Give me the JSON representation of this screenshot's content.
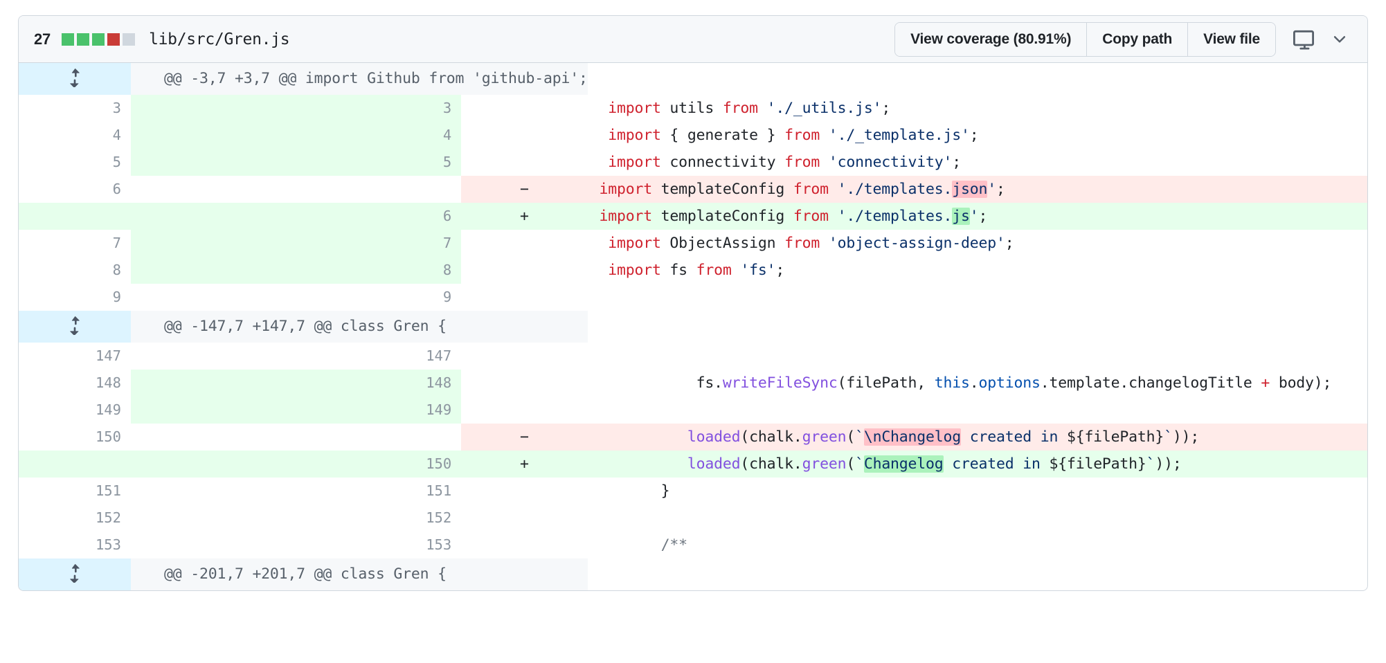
{
  "header": {
    "change_count": "27",
    "stat_blocks": [
      "#4ac26b",
      "#4ac26b",
      "#4ac26b",
      "#c93c37",
      "#d0d7de"
    ],
    "file_path": "lib/src/Gren.js",
    "buttons": [
      {
        "label": "View coverage (80.91%)",
        "name": "view-coverage-button"
      },
      {
        "label": "Copy path",
        "name": "copy-path-button"
      },
      {
        "label": "View file",
        "name": "view-file-button"
      }
    ],
    "icons": {
      "display": "display-icon",
      "chevron": "chevron-down-icon"
    }
  },
  "colors": {
    "accent_blue": "#0969da",
    "addition_bg": "#e6ffec",
    "deletion_bg": "#ffebe9",
    "hunk_bg": "#f6f8fa",
    "expand_bg": "#ddf4ff",
    "word_del_bg": "#ffc0c7",
    "word_add_bg": "#abf2bc",
    "border": "#d0d7de"
  },
  "hunks": [
    {
      "header": "@@ -3,7 +3,7 @@ import Github from 'github-api';",
      "rows": [
        {
          "type": "ctx",
          "old": "3",
          "new": "3",
          "marker": "",
          "gutter_green": true,
          "tokens": [
            {
              "t": "  ",
              "c": "pl"
            },
            {
              "t": "import",
              "c": "k"
            },
            {
              "t": " utils ",
              "c": "pl"
            },
            {
              "t": "from",
              "c": "k"
            },
            {
              "t": " ",
              "c": "pl"
            },
            {
              "t": "'./_utils.js'",
              "c": "s"
            },
            {
              "t": ";",
              "c": "pl"
            }
          ]
        },
        {
          "type": "ctx",
          "old": "4",
          "new": "4",
          "marker": "",
          "gutter_green": true,
          "tokens": [
            {
              "t": "  ",
              "c": "pl"
            },
            {
              "t": "import",
              "c": "k"
            },
            {
              "t": " { generate } ",
              "c": "pl"
            },
            {
              "t": "from",
              "c": "k"
            },
            {
              "t": " ",
              "c": "pl"
            },
            {
              "t": "'./_template.js'",
              "c": "s"
            },
            {
              "t": ";",
              "c": "pl"
            }
          ]
        },
        {
          "type": "ctx",
          "old": "5",
          "new": "5",
          "marker": "",
          "gutter_green": true,
          "tokens": [
            {
              "t": "  ",
              "c": "pl"
            },
            {
              "t": "import",
              "c": "k"
            },
            {
              "t": " connectivity ",
              "c": "pl"
            },
            {
              "t": "from",
              "c": "k"
            },
            {
              "t": " ",
              "c": "pl"
            },
            {
              "t": "'connectivity'",
              "c": "s"
            },
            {
              "t": ";",
              "c": "pl"
            }
          ]
        },
        {
          "type": "del",
          "old": "6",
          "new": "",
          "marker": "−",
          "gutter_green": false,
          "tokens": [
            {
              "t": " ",
              "c": "pl"
            },
            {
              "t": "import",
              "c": "k"
            },
            {
              "t": " templateConfig ",
              "c": "pl"
            },
            {
              "t": "from",
              "c": "k"
            },
            {
              "t": " ",
              "c": "pl"
            },
            {
              "t": "'./templates.",
              "c": "s"
            },
            {
              "t": "json",
              "c": "s",
              "hl": "del"
            },
            {
              "t": "'",
              "c": "s"
            },
            {
              "t": ";",
              "c": "pl"
            }
          ]
        },
        {
          "type": "add",
          "old": "",
          "new": "6",
          "marker": "+",
          "gutter_green": true,
          "tokens": [
            {
              "t": " ",
              "c": "pl"
            },
            {
              "t": "import",
              "c": "k"
            },
            {
              "t": " templateConfig ",
              "c": "pl"
            },
            {
              "t": "from",
              "c": "k"
            },
            {
              "t": " ",
              "c": "pl"
            },
            {
              "t": "'./templates.",
              "c": "s"
            },
            {
              "t": "js",
              "c": "s",
              "hl": "add"
            },
            {
              "t": "'",
              "c": "s"
            },
            {
              "t": ";",
              "c": "pl"
            }
          ]
        },
        {
          "type": "ctx",
          "old": "7",
          "new": "7",
          "marker": "",
          "gutter_green": true,
          "tokens": [
            {
              "t": "  ",
              "c": "pl"
            },
            {
              "t": "import",
              "c": "k"
            },
            {
              "t": " ObjectAssign ",
              "c": "pl"
            },
            {
              "t": "from",
              "c": "k"
            },
            {
              "t": " ",
              "c": "pl"
            },
            {
              "t": "'object-assign-deep'",
              "c": "s"
            },
            {
              "t": ";",
              "c": "pl"
            }
          ]
        },
        {
          "type": "ctx",
          "old": "8",
          "new": "8",
          "marker": "",
          "gutter_green": true,
          "tokens": [
            {
              "t": "  ",
              "c": "pl"
            },
            {
              "t": "import",
              "c": "k"
            },
            {
              "t": " fs ",
              "c": "pl"
            },
            {
              "t": "from",
              "c": "k"
            },
            {
              "t": " ",
              "c": "pl"
            },
            {
              "t": "'fs'",
              "c": "s"
            },
            {
              "t": ";",
              "c": "pl"
            }
          ]
        },
        {
          "type": "ctx",
          "old": "9",
          "new": "9",
          "marker": "",
          "gutter_green": false,
          "tokens": []
        }
      ]
    },
    {
      "header": "@@ -147,7 +147,7 @@ class Gren {",
      "rows": [
        {
          "type": "ctx",
          "old": "147",
          "new": "147",
          "marker": "",
          "gutter_green": false,
          "tokens": []
        },
        {
          "type": "ctx",
          "old": "148",
          "new": "148",
          "marker": "",
          "gutter_green": true,
          "tokens": [
            {
              "t": "            fs.",
              "c": "pl"
            },
            {
              "t": "writeFileSync",
              "c": "f"
            },
            {
              "t": "(filePath, ",
              "c": "pl"
            },
            {
              "t": "this",
              "c": "e"
            },
            {
              "t": ".",
              "c": "pl"
            },
            {
              "t": "options",
              "c": "e"
            },
            {
              "t": ".template.changelogTitle ",
              "c": "pl"
            },
            {
              "t": "+",
              "c": "k"
            },
            {
              "t": " body);",
              "c": "pl"
            }
          ]
        },
        {
          "type": "ctx",
          "old": "149",
          "new": "149",
          "marker": "",
          "gutter_green": true,
          "tokens": []
        },
        {
          "type": "del",
          "old": "150",
          "new": "",
          "marker": "−",
          "gutter_green": false,
          "tokens": [
            {
              "t": "           ",
              "c": "pl"
            },
            {
              "t": "loaded",
              "c": "f"
            },
            {
              "t": "(chalk.",
              "c": "pl"
            },
            {
              "t": "green",
              "c": "f"
            },
            {
              "t": "(",
              "c": "pl"
            },
            {
              "t": "`",
              "c": "s"
            },
            {
              "t": "\\nChangelog",
              "c": "s",
              "hl": "del"
            },
            {
              "t": " created in ",
              "c": "s"
            },
            {
              "t": "${filePath}",
              "c": "pl"
            },
            {
              "t": "`",
              "c": "s"
            },
            {
              "t": "));",
              "c": "pl"
            }
          ]
        },
        {
          "type": "add",
          "old": "",
          "new": "150",
          "marker": "+",
          "gutter_green": true,
          "tokens": [
            {
              "t": "           ",
              "c": "pl"
            },
            {
              "t": "loaded",
              "c": "f"
            },
            {
              "t": "(chalk.",
              "c": "pl"
            },
            {
              "t": "green",
              "c": "f"
            },
            {
              "t": "(",
              "c": "pl"
            },
            {
              "t": "`",
              "c": "s"
            },
            {
              "t": "Changelog",
              "c": "s",
              "hl": "add"
            },
            {
              "t": " created in ",
              "c": "s"
            },
            {
              "t": "${filePath}",
              "c": "pl"
            },
            {
              "t": "`",
              "c": "s"
            },
            {
              "t": "));",
              "c": "pl"
            }
          ]
        },
        {
          "type": "ctx",
          "old": "151",
          "new": "151",
          "marker": "",
          "gutter_green": false,
          "tokens": [
            {
              "t": "        }",
              "c": "pl"
            }
          ]
        },
        {
          "type": "ctx",
          "old": "152",
          "new": "152",
          "marker": "",
          "gutter_green": false,
          "tokens": []
        },
        {
          "type": "ctx",
          "old": "153",
          "new": "153",
          "marker": "",
          "gutter_green": false,
          "tokens": [
            {
              "t": "        ",
              "c": "pl"
            },
            {
              "t": "/**",
              "c": "c"
            }
          ]
        }
      ]
    },
    {
      "header": "@@ -201,7 +201,7 @@ class Gren {",
      "rows": []
    }
  ]
}
